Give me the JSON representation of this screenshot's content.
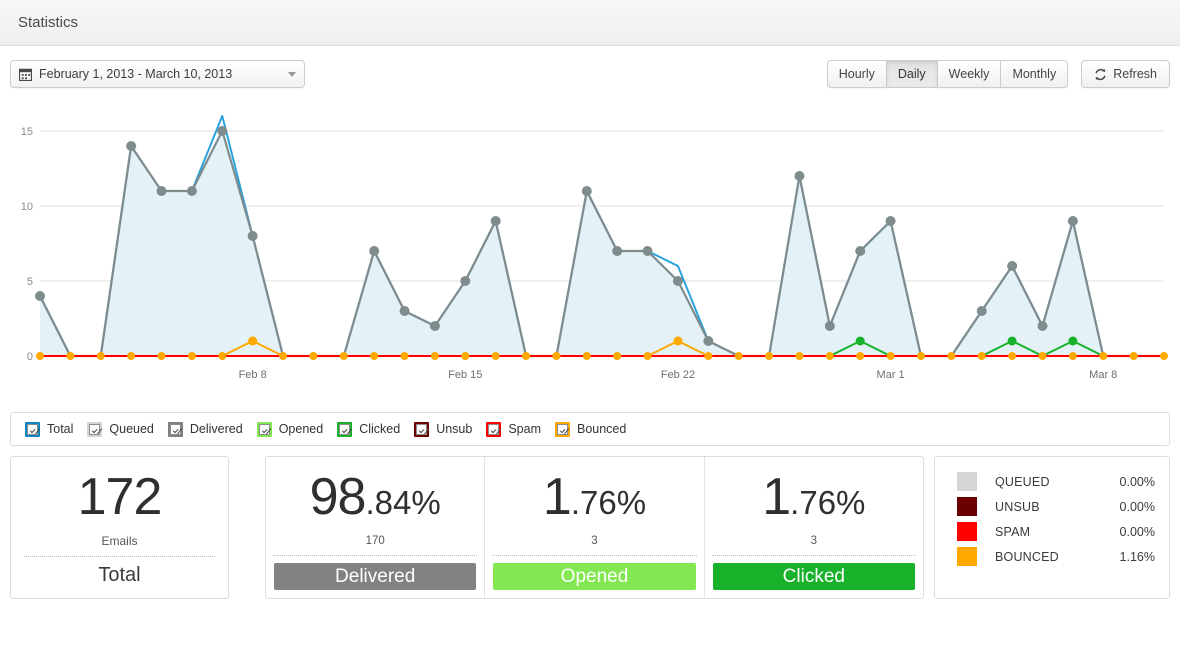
{
  "header": {
    "title": "Statistics"
  },
  "toolbar": {
    "date_range": "February 1, 2013 - March 10, 2013",
    "calendar_icon": "calendar-icon",
    "caret_icon": "chevron-down-icon",
    "refresh_label": "Refresh",
    "refresh_icon": "refresh-icon",
    "intervals": [
      {
        "label": "Hourly",
        "active": false
      },
      {
        "label": "Daily",
        "active": true
      },
      {
        "label": "Weekly",
        "active": false
      },
      {
        "label": "Monthly",
        "active": false
      }
    ]
  },
  "legend": [
    {
      "label": "Total",
      "color": "#0e86c4",
      "checked": true
    },
    {
      "label": "Queued",
      "color": "#d5d5d5",
      "checked": true
    },
    {
      "label": "Delivered",
      "color": "#7f8080",
      "checked": true
    },
    {
      "label": "Opened",
      "color": "#82e750",
      "checked": true
    },
    {
      "label": "Clicked",
      "color": "#17b22a",
      "checked": true
    },
    {
      "label": "Unsub",
      "color": "#6b0000",
      "checked": true
    },
    {
      "label": "Spam",
      "color": "#ff0000",
      "checked": true
    },
    {
      "label": "Bounced",
      "color": "#ffa800",
      "checked": true
    }
  ],
  "cards": {
    "total": {
      "value": "172",
      "unit": "Emails",
      "label": "Total"
    },
    "metrics": [
      {
        "int": "98",
        "frac": ".84%",
        "count": "170",
        "label": "Delivered",
        "color": "#828282"
      },
      {
        "int": "1",
        "frac": ".76%",
        "count": "3",
        "label": "Opened",
        "color": "#82e750"
      },
      {
        "int": "1",
        "frac": ".76%",
        "count": "3",
        "label": "Clicked",
        "color": "#17b22a"
      }
    ]
  },
  "summary": [
    {
      "name": "QUEUED",
      "value": "0.00%",
      "color": "#d5d5d5"
    },
    {
      "name": "UNSUB",
      "value": "0.00%",
      "color": "#6b0000"
    },
    {
      "name": "SPAM",
      "value": "0.00%",
      "color": "#ff0000"
    },
    {
      "name": "BOUNCED",
      "value": "1.16%",
      "color": "#ffa800"
    }
  ],
  "chart_data": {
    "type": "line",
    "title": "",
    "xlabel": "",
    "ylabel": "",
    "ylim": [
      0,
      16
    ],
    "yticks": [
      0,
      5,
      10,
      15
    ],
    "grid": true,
    "legend_position": "below",
    "x": [
      "Feb 1",
      "Feb 2",
      "Feb 3",
      "Feb 4",
      "Feb 5",
      "Feb 6",
      "Feb 7",
      "Feb 8",
      "Feb 9",
      "Feb 10",
      "Feb 11",
      "Feb 12",
      "Feb 13",
      "Feb 14",
      "Feb 15",
      "Feb 16",
      "Feb 17",
      "Feb 18",
      "Feb 19",
      "Feb 20",
      "Feb 21",
      "Feb 22",
      "Feb 23",
      "Feb 24",
      "Feb 25",
      "Feb 26",
      "Feb 27",
      "Feb 28",
      "Mar 1",
      "Mar 2",
      "Mar 3",
      "Mar 4",
      "Mar 5",
      "Mar 6",
      "Mar 7",
      "Mar 8",
      "Mar 9",
      "Mar 10"
    ],
    "xticks": [
      "Feb 8",
      "Feb 15",
      "Feb 22",
      "Mar 1",
      "Mar 8"
    ],
    "xtick_indices": [
      7,
      14,
      21,
      28,
      35
    ],
    "series": [
      {
        "name": "Total",
        "color": "#29a3dd",
        "fill": false,
        "markers": false,
        "values": [
          4,
          0,
          0,
          14,
          11,
          11,
          16,
          8,
          0,
          0,
          0,
          7,
          3,
          2,
          5,
          9,
          0,
          0,
          11,
          7,
          7,
          6,
          1,
          0,
          0,
          12,
          2,
          7,
          9,
          0,
          0,
          3,
          6,
          2,
          9,
          0,
          0,
          0
        ]
      },
      {
        "name": "Delivered",
        "color": "#7f8c8d",
        "fill": true,
        "markers": true,
        "values": [
          4,
          0,
          0,
          14,
          11,
          11,
          15,
          8,
          0,
          0,
          0,
          7,
          3,
          2,
          5,
          9,
          0,
          0,
          11,
          7,
          7,
          5,
          1,
          0,
          0,
          12,
          2,
          7,
          9,
          0,
          0,
          3,
          6,
          2,
          9,
          0,
          0,
          0
        ]
      },
      {
        "name": "Clicked",
        "color": "#17b22a",
        "fill": false,
        "markers": true,
        "values": [
          0,
          0,
          0,
          0,
          0,
          0,
          0,
          0,
          0,
          0,
          0,
          0,
          0,
          0,
          0,
          0,
          0,
          0,
          0,
          0,
          0,
          0,
          0,
          0,
          0,
          0,
          0,
          1,
          0,
          0,
          0,
          0,
          1,
          0,
          1,
          0,
          0,
          0
        ]
      },
      {
        "name": "Bounced",
        "color": "#ffa800",
        "fill": false,
        "markers": true,
        "values": [
          0,
          0,
          0,
          0,
          0,
          0,
          0,
          1,
          0,
          0,
          0,
          0,
          0,
          0,
          0,
          0,
          0,
          0,
          0,
          0,
          0,
          1,
          0,
          0,
          0,
          0,
          0,
          0,
          0,
          0,
          0,
          0,
          0,
          0,
          0,
          0,
          0,
          0
        ]
      },
      {
        "name": "Spam",
        "color": "#ff0000",
        "fill": false,
        "markers": true,
        "values": [
          0,
          0,
          0,
          0,
          0,
          0,
          0,
          0,
          0,
          0,
          0,
          0,
          0,
          0,
          0,
          0,
          0,
          0,
          0,
          0,
          0,
          0,
          0,
          0,
          0,
          0,
          0,
          0,
          0,
          0,
          0,
          0,
          0,
          0,
          0,
          0,
          0,
          0
        ]
      }
    ]
  }
}
